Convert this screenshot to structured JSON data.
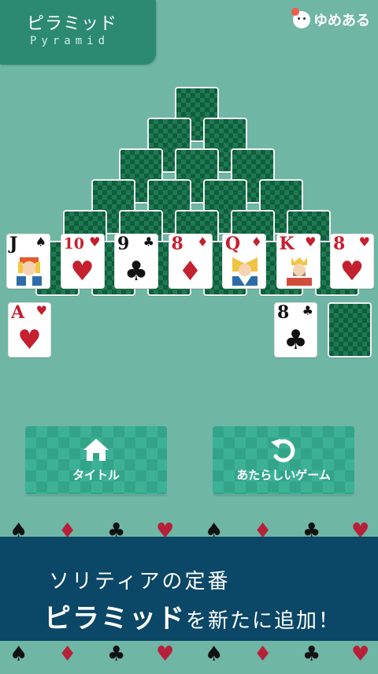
{
  "header": {
    "title_jp": "ピラミッド",
    "title_en": "Pyramid",
    "brand": "ゆめある"
  },
  "pyramid_rows": [
    1,
    2,
    3,
    4,
    5,
    6
  ],
  "bottom_row": [
    {
      "rank": "J",
      "suit": "♠",
      "color": "black",
      "face": "jack"
    },
    {
      "rank": "10",
      "suit": "♥",
      "color": "red",
      "face": null
    },
    {
      "rank": "9",
      "suit": "♣",
      "color": "black",
      "face": null
    },
    {
      "rank": "8",
      "suit": "♦",
      "color": "red",
      "face": null
    },
    {
      "rank": "Q",
      "suit": "♦",
      "color": "red",
      "face": "queen"
    },
    {
      "rank": "K",
      "suit": "♥",
      "color": "red",
      "face": "king"
    },
    {
      "rank": "8",
      "suit": "♥",
      "color": "red",
      "face": null
    }
  ],
  "waste_left": {
    "rank": "A",
    "suit": "♥",
    "color": "red"
  },
  "waste_right": {
    "rank": "8",
    "suit": "♣",
    "color": "black"
  },
  "buttons": {
    "title_label": "タイトル",
    "new_game_label": "あたらしいゲーム"
  },
  "banner": {
    "line1": "ソリティアの定番",
    "line2_strong": "ピラミッド",
    "line2_rest": "を新たに追加！"
  },
  "colors": {
    "bg": "#6fb6a5",
    "tab": "#2c8a72",
    "banner": "#0b4766",
    "red": "#c4202f"
  }
}
